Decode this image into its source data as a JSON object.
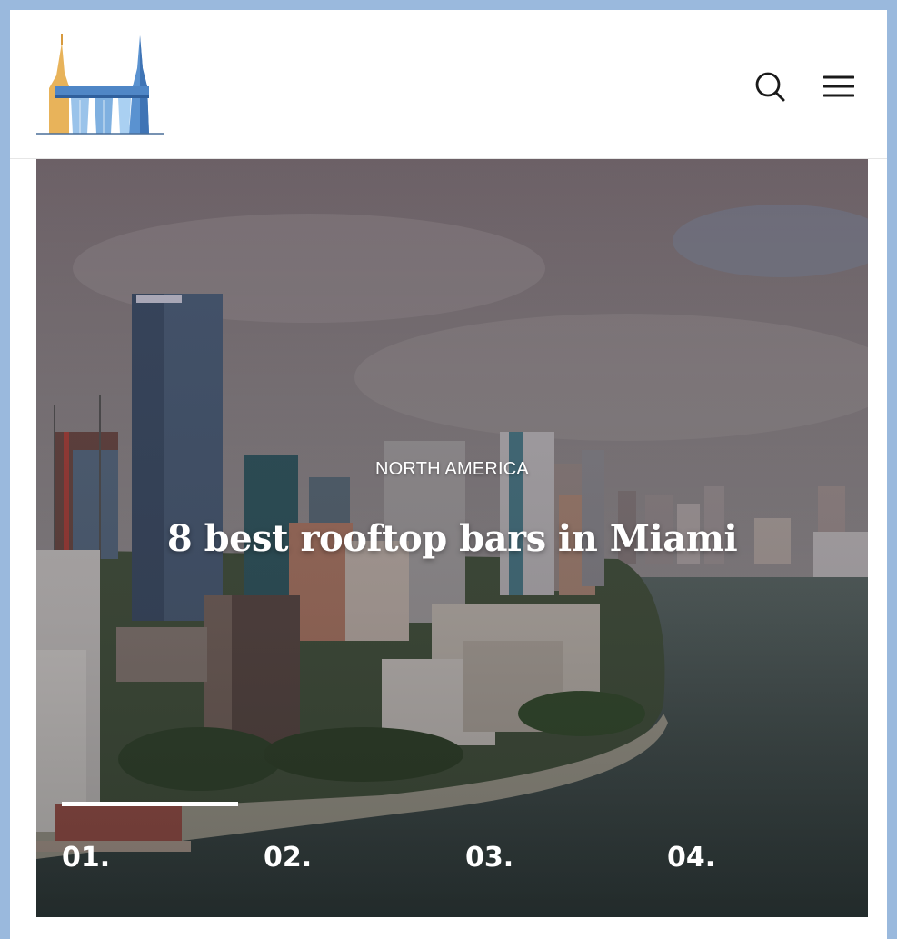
{
  "header": {
    "logo_icon": "skyline-logo-icon",
    "search_icon": "search-icon",
    "menu_icon": "hamburger-menu-icon"
  },
  "hero": {
    "category": "NORTH AMERICA",
    "title": "8 best rooftop bars in Miami",
    "slides": [
      {
        "label": "01.",
        "active": true
      },
      {
        "label": "02.",
        "active": false
      },
      {
        "label": "03.",
        "active": false
      },
      {
        "label": "04.",
        "active": false
      }
    ]
  },
  "colors": {
    "frame_border": "#9ab9dd",
    "logo_gold": "#e8b35a",
    "logo_blue": "#4f86c6",
    "text_on_image": "#ffffff"
  }
}
